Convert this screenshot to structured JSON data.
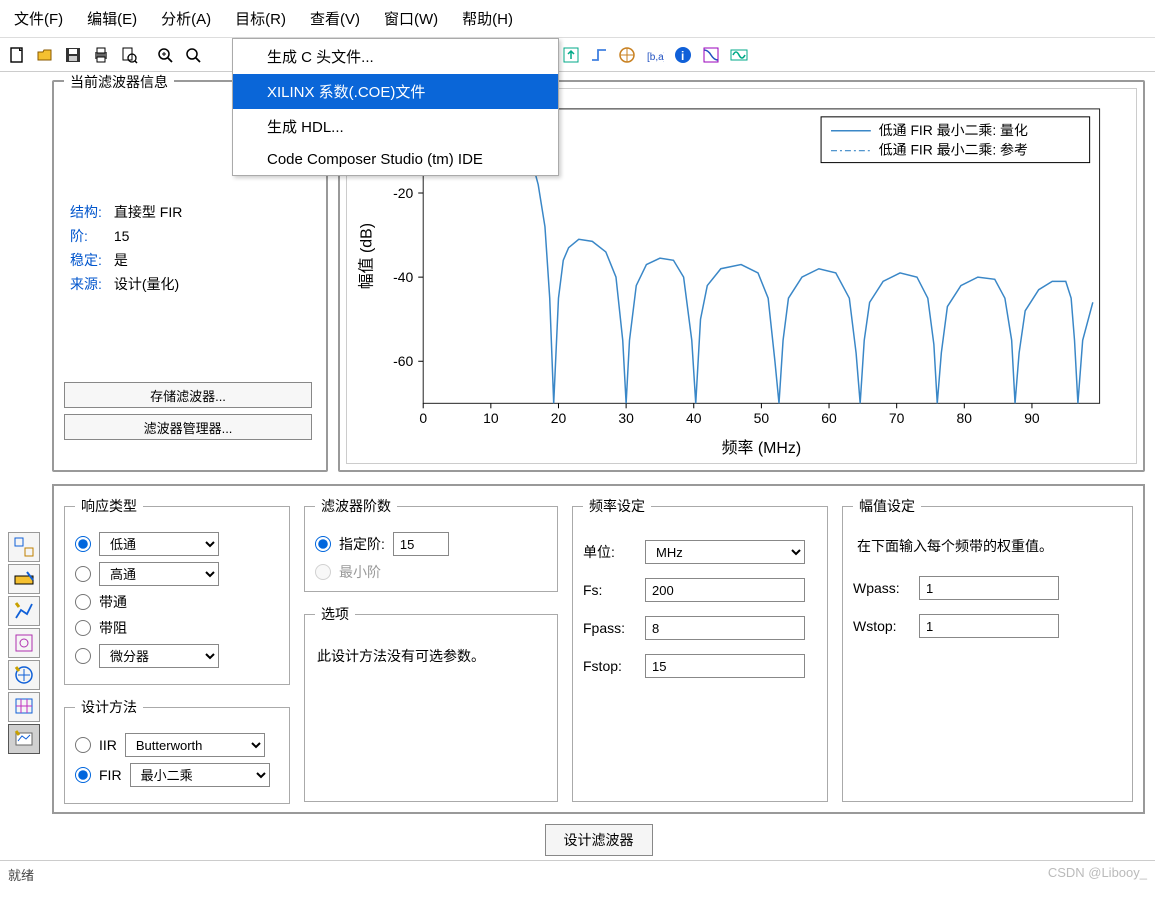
{
  "menubar": [
    "文件(F)",
    "编辑(E)",
    "分析(A)",
    "目标(R)",
    "查看(V)",
    "窗口(W)",
    "帮助(H)"
  ],
  "dropdown": {
    "items": [
      "生成 C 头文件...",
      "XILINX 系数(.COE)文件",
      "生成 HDL...",
      "Code Composer Studio (tm) IDE"
    ],
    "highlighted_index": 1
  },
  "toolbar_icons": [
    "new",
    "open",
    "save",
    "print",
    "preview",
    "",
    "zoom-in",
    "zoom-rect",
    "",
    "mag-response",
    "phase",
    "impulse",
    "step",
    "group-delay",
    "filter-coeff",
    "pole-zero",
    "info",
    "quantize",
    "round"
  ],
  "filter_info": {
    "title": "当前滤波器信息",
    "rows": [
      {
        "label": "结构:",
        "value": "直接型 FIR"
      },
      {
        "label": "阶:",
        "value": "15"
      },
      {
        "label": "稳定:",
        "value": "是"
      },
      {
        "label": "来源:",
        "value": "设计(量化)"
      }
    ],
    "store_btn": "存储滤波器...",
    "manage_btn": "滤波器管理器..."
  },
  "chart_data": {
    "type": "line",
    "title": "",
    "xlabel": "频率 (MHz)",
    "ylabel": "幅值 (dB)",
    "xlim": [
      0,
      100
    ],
    "ylim": [
      -70,
      0
    ],
    "xticks": [
      0,
      10,
      20,
      30,
      40,
      50,
      60,
      70,
      80,
      90
    ],
    "yticks": [
      0,
      -20,
      -40,
      -60
    ],
    "legend": [
      "低通 FIR 最小二乘: 量化",
      "低通 FIR 最小二乘: 参考"
    ],
    "series": [
      {
        "name": "量化",
        "style": "solid",
        "color": "#3a87c7",
        "x": [
          0,
          2,
          4,
          6,
          8,
          10,
          12,
          14,
          16,
          17,
          18,
          18.7,
          19.3,
          20,
          20.7,
          21.5,
          23,
          25,
          27,
          28.5,
          29.5,
          30,
          30.5,
          31.5,
          33,
          35,
          37,
          38.5,
          39.7,
          40.3,
          41,
          42,
          44,
          47,
          49.5,
          51,
          52,
          52.6,
          53.2,
          54,
          56,
          58.5,
          61,
          63,
          64,
          64.6,
          65.2,
          66,
          68,
          70.5,
          73,
          74.6,
          75.5,
          76,
          76.6,
          77.5,
          79.5,
          82,
          84.5,
          86,
          87,
          87.5,
          88.1,
          89,
          91,
          93,
          95,
          95.8,
          96.3,
          96.8,
          97.5,
          99
        ],
        "y": [
          0,
          0,
          -0.1,
          -0.3,
          -0.7,
          -1.5,
          -3,
          -6,
          -12,
          -18,
          -28,
          -45,
          -70,
          -45,
          -36,
          -33,
          -31,
          -31.5,
          -34,
          -40,
          -55,
          -70,
          -55,
          -42,
          -37,
          -35.5,
          -36,
          -40,
          -55,
          -70,
          -50,
          -42,
          -38,
          -37,
          -39,
          -45,
          -60,
          -70,
          -55,
          -45,
          -40,
          -38,
          -39,
          -45,
          -58,
          -70,
          -55,
          -46,
          -41,
          -39,
          -40,
          -45,
          -56,
          -70,
          -58,
          -47,
          -42,
          -40,
          -40.5,
          -45,
          -55,
          -70,
          -58,
          -48,
          -43,
          -41,
          -41,
          -45,
          -55,
          -70,
          -55,
          -46
        ]
      }
    ]
  },
  "resp": {
    "title": "响应类型",
    "options": [
      "低通",
      "高通",
      "带通",
      "带阻",
      "微分器"
    ],
    "selected": 0
  },
  "design_method": {
    "title": "设计方法",
    "iir_label": "IIR",
    "iir_value": "Butterworth",
    "fir_label": "FIR",
    "fir_value": "最小二乘",
    "selected": "FIR"
  },
  "order": {
    "title": "滤波器阶数",
    "specify_label": "指定阶:",
    "specify_value": "15",
    "min_label": "最小阶",
    "selected": "specify"
  },
  "options": {
    "title": "选项",
    "text": "此设计方法没有可选参数。"
  },
  "freq": {
    "title": "频率设定",
    "unit_label": "单位:",
    "unit_value": "MHz",
    "rows": [
      {
        "label": "Fs:",
        "value": "200"
      },
      {
        "label": "Fpass:",
        "value": "8"
      },
      {
        "label": "Fstop:",
        "value": "15"
      }
    ]
  },
  "mag": {
    "title": "幅值设定",
    "hint": "在下面输入每个频带的权重值。",
    "rows": [
      {
        "label": "Wpass:",
        "value": "1"
      },
      {
        "label": "Wstop:",
        "value": "1"
      }
    ]
  },
  "design_btn": "设计滤波器",
  "status_left": "就绪",
  "status_right": "CSDN @Libooy_"
}
